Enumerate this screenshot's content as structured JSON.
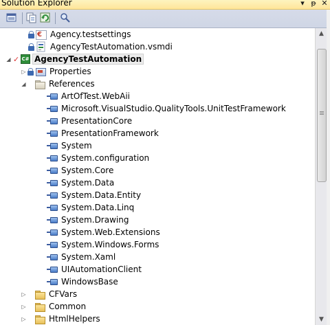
{
  "window": {
    "title": "Solution Explorer",
    "buttons": {
      "dropdown": "▾",
      "pin": "ᵽ",
      "close": "✕"
    }
  },
  "toolbar": {
    "buttons": [
      "properties-icon",
      "show-all-files-icon",
      "refresh-icon",
      "class-diagram-icon"
    ]
  },
  "tree": {
    "solution_items": [
      {
        "label": "Agency.testsettings",
        "icon": "testsettings-file-icon",
        "locked": true
      },
      {
        "label": "AgencyTestAutomation.vsmdi",
        "icon": "vsmdi-file-icon",
        "locked": true
      }
    ],
    "project": {
      "label": "AgencyTestAutomation",
      "icon": "csharp-project-icon",
      "expanded": true
    },
    "properties": {
      "label": "Properties"
    },
    "references": {
      "label": "References",
      "items": [
        "ArtOfTest.WebAii",
        "Microsoft.VisualStudio.QualityTools.UnitTestFramework",
        "PresentationCore",
        "PresentationFramework",
        "System",
        "System.configuration",
        "System.Core",
        "System.Data",
        "System.Data.Entity",
        "System.Data.Linq",
        "System.Drawing",
        "System.Web.Extensions",
        "System.Windows.Forms",
        "System.Xaml",
        "UIAutomationClient",
        "WindowsBase"
      ]
    },
    "folders": [
      "CFVars",
      "Common",
      "HtmlHelpers"
    ]
  },
  "scrollbar": {
    "position_fraction": 0.0
  }
}
